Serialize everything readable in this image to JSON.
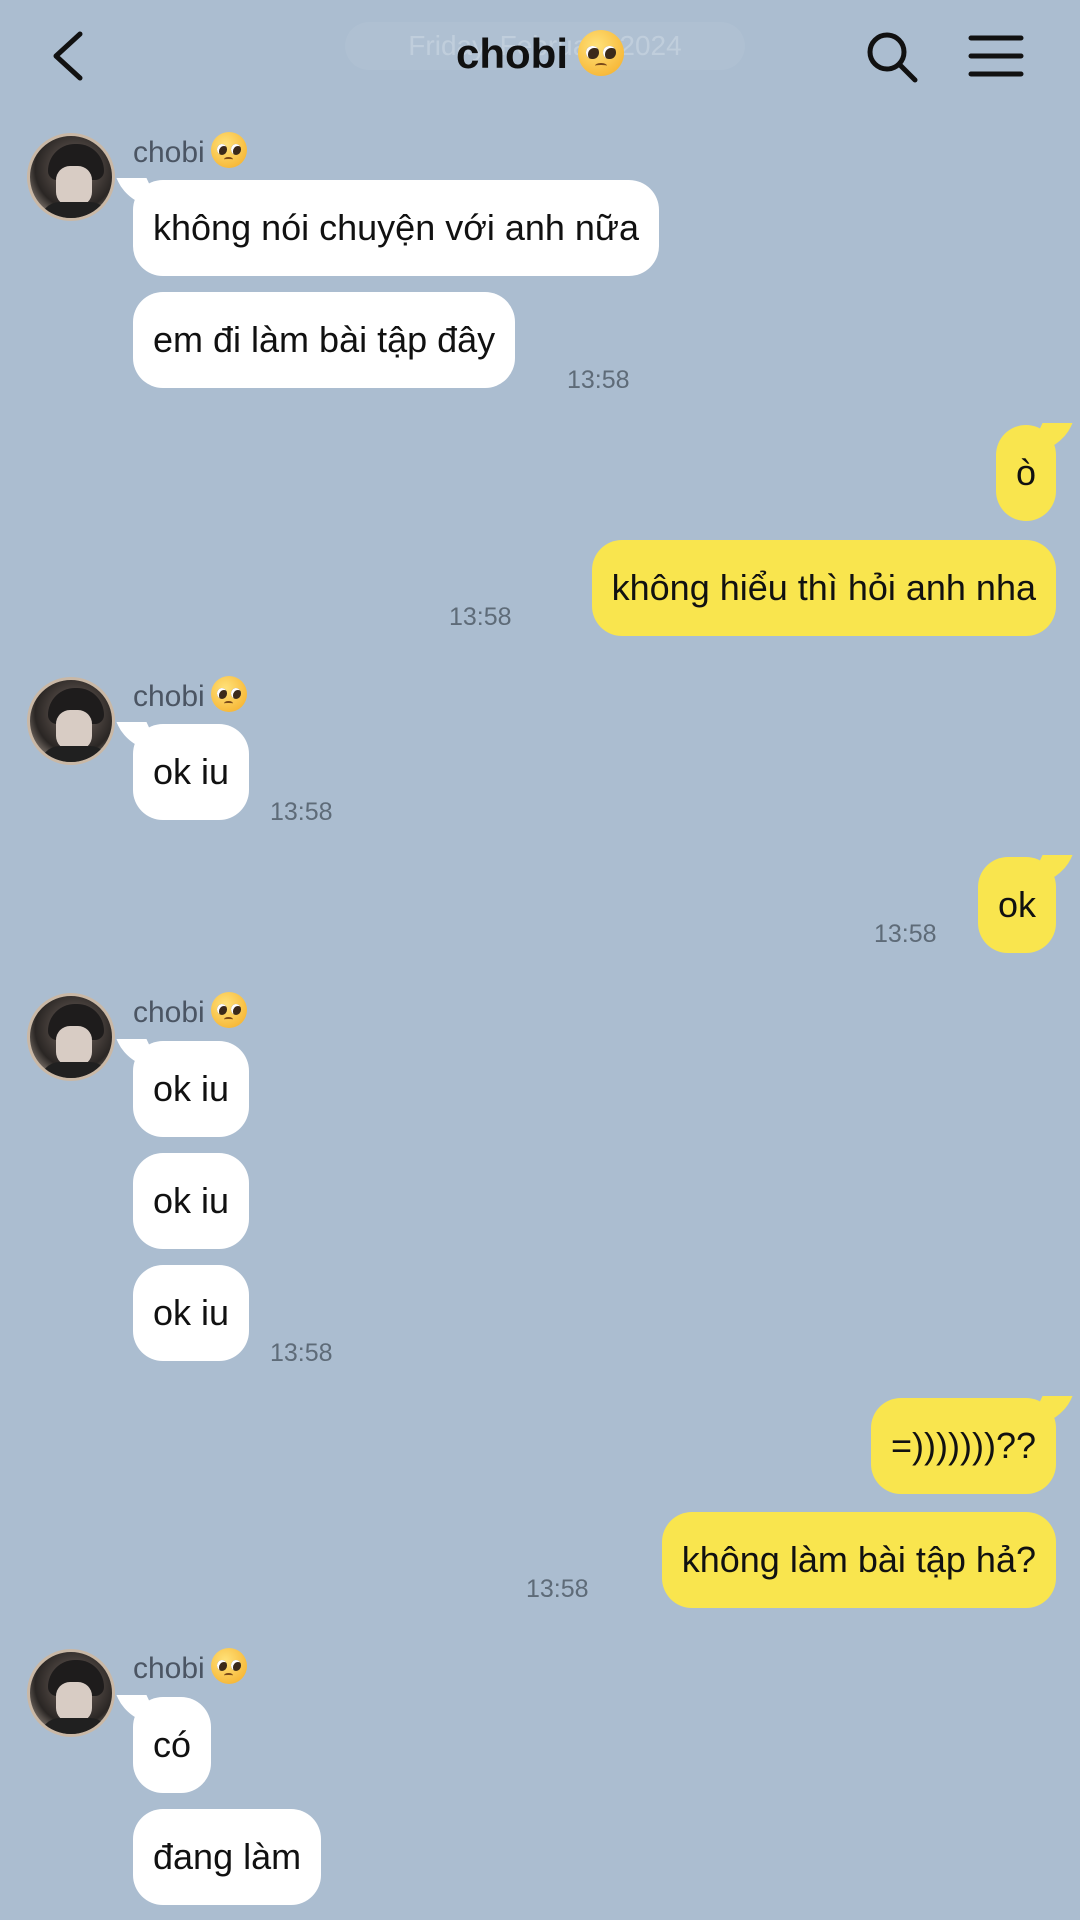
{
  "header": {
    "title": "chobi",
    "ghost_date": "Friday, February 2024"
  },
  "contact": {
    "name": "chobi",
    "emoji": "pleading-face"
  },
  "messages": {
    "m1": "không nói chuyện với anh nữa",
    "m2": "em đi làm bài tập đây",
    "t1": "13:58",
    "m3": "ò",
    "m4": "không hiểu thì hỏi anh nha",
    "t2": "13:58",
    "m5": "ok iu",
    "t3": "13:58",
    "m6": "ok",
    "t4": "13:58",
    "m7": "ok iu",
    "m8": "ok iu",
    "m9": "ok iu",
    "t5": "13:58",
    "m10": "=)))))))??",
    "m11": "không làm bài tập hả?",
    "t6": "13:58",
    "m12": "có",
    "m13": "đang làm"
  },
  "colors": {
    "background": "#abbdd0",
    "incoming_bubble": "#ffffff",
    "outgoing_bubble": "#f9e54e"
  }
}
